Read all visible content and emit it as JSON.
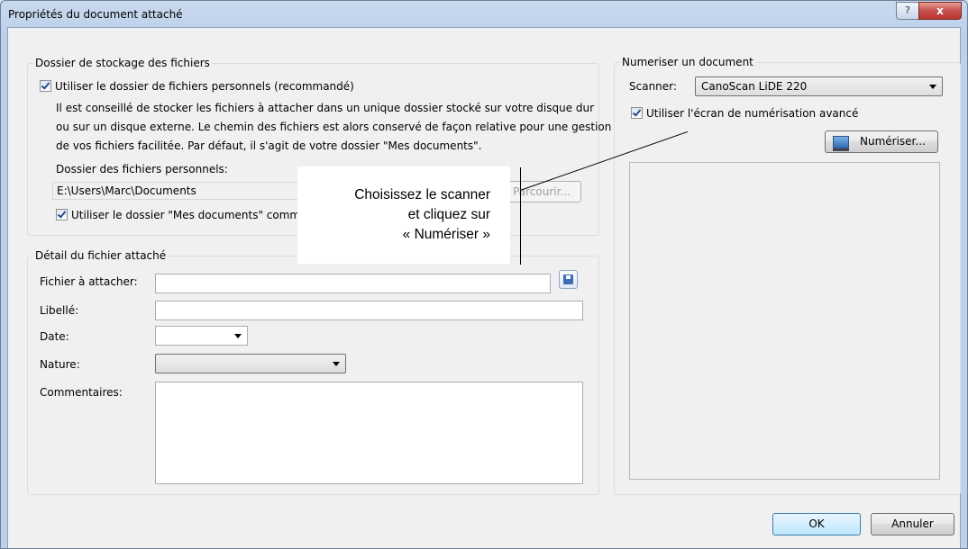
{
  "window": {
    "title": "Propriétés du document attaché",
    "help_label": "?",
    "close_label": "x"
  },
  "storage": {
    "group_title": "Dossier de stockage des fichiers",
    "use_personal_label": "Utiliser le dossier de fichiers personnels (recommandé)",
    "use_personal_checked": true,
    "description_lines": [
      "Il est conseillé de stocker les fichiers à attacher dans un unique dossier stocké sur votre disque dur",
      "ou sur un disque externe. Le chemin des fichiers est alors conservé de façon relative pour une gestion",
      "de vos fichiers facilitée. Par défaut, il s'agit de votre dossier \"Mes documents\"."
    ],
    "folder_label": "Dossier des fichiers personnels:",
    "folder_value": "E:\\Users\\Marc\\Documents",
    "browse_label": "Parcourir...",
    "use_my_docs_label": "Utiliser le dossier \"Mes documents\" comme",
    "use_my_docs_checked": true
  },
  "detail": {
    "group_title": "Détail du fichier attaché",
    "file_label": "Fichier à attacher:",
    "file_value": "",
    "label_label": "Libellé:",
    "label_value": "",
    "date_label": "Date:",
    "date_value": "",
    "nature_label": "Nature:",
    "nature_value": "",
    "comments_label": "Commentaires:",
    "comments_value": ""
  },
  "scan": {
    "group_title": "Numeriser un document",
    "scanner_label": "Scanner:",
    "scanner_value": "CanoScan LiDE 220",
    "advanced_label": "Utiliser l'écran de numérisation avancé",
    "advanced_checked": true,
    "scan_button_label": "Numériser..."
  },
  "callout": {
    "lines": [
      "Choisissez le scanner",
      "et cliquez sur",
      "« Numériser »"
    ]
  },
  "footer": {
    "ok_label": "OK",
    "cancel_label": "Annuler"
  },
  "icons": {
    "save": "save-icon",
    "scan": "scanner-icon",
    "close": "close-icon",
    "help": "help-icon"
  }
}
